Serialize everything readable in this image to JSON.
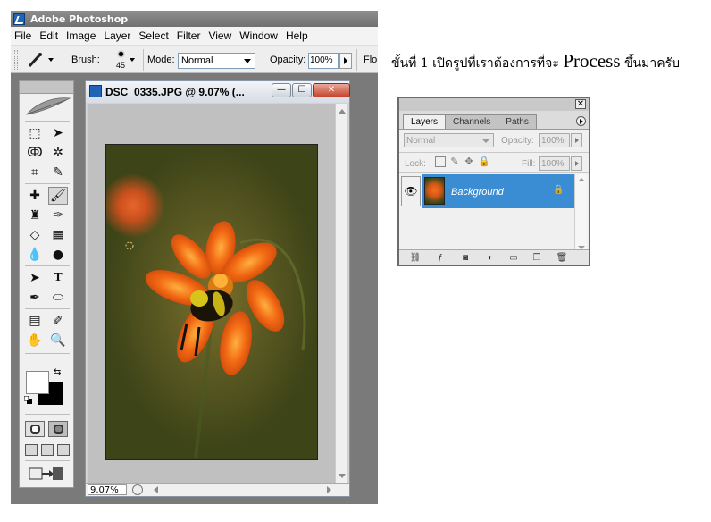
{
  "app": {
    "title": "Adobe Photoshop"
  },
  "menubar": [
    "File",
    "Edit",
    "Image",
    "Layer",
    "Select",
    "Filter",
    "View",
    "Window",
    "Help"
  ],
  "options_bar": {
    "brush_label": "Brush:",
    "brush_size": "45",
    "mode_label": "Mode:",
    "mode_value": "Normal",
    "opacity_label": "Opacity:",
    "opacity_value": "100%",
    "flow_label": "Flo"
  },
  "document": {
    "title": "DSC_0335.JPG @ 9.07% (...",
    "zoom": "9.07%"
  },
  "layers_panel": {
    "tabs": [
      "Layers",
      "Channels",
      "Paths"
    ],
    "active_tab": "Layers",
    "blend_mode": "Normal",
    "opacity_label": "Opacity:",
    "opacity_value": "100%",
    "lock_label": "Lock:",
    "fill_label": "Fill:",
    "fill_value": "100%",
    "layer_name": "Background"
  },
  "caption": {
    "prefix": "ขั้นที่ 1 เปิดรูปที่เราต้องการที่จะ",
    "highlight": "Process",
    "suffix": "ขึ้นมาครับ"
  },
  "colors": {
    "selected_layer": "#3b8dd3",
    "foreground": "#ffffff",
    "background": "#000000"
  }
}
